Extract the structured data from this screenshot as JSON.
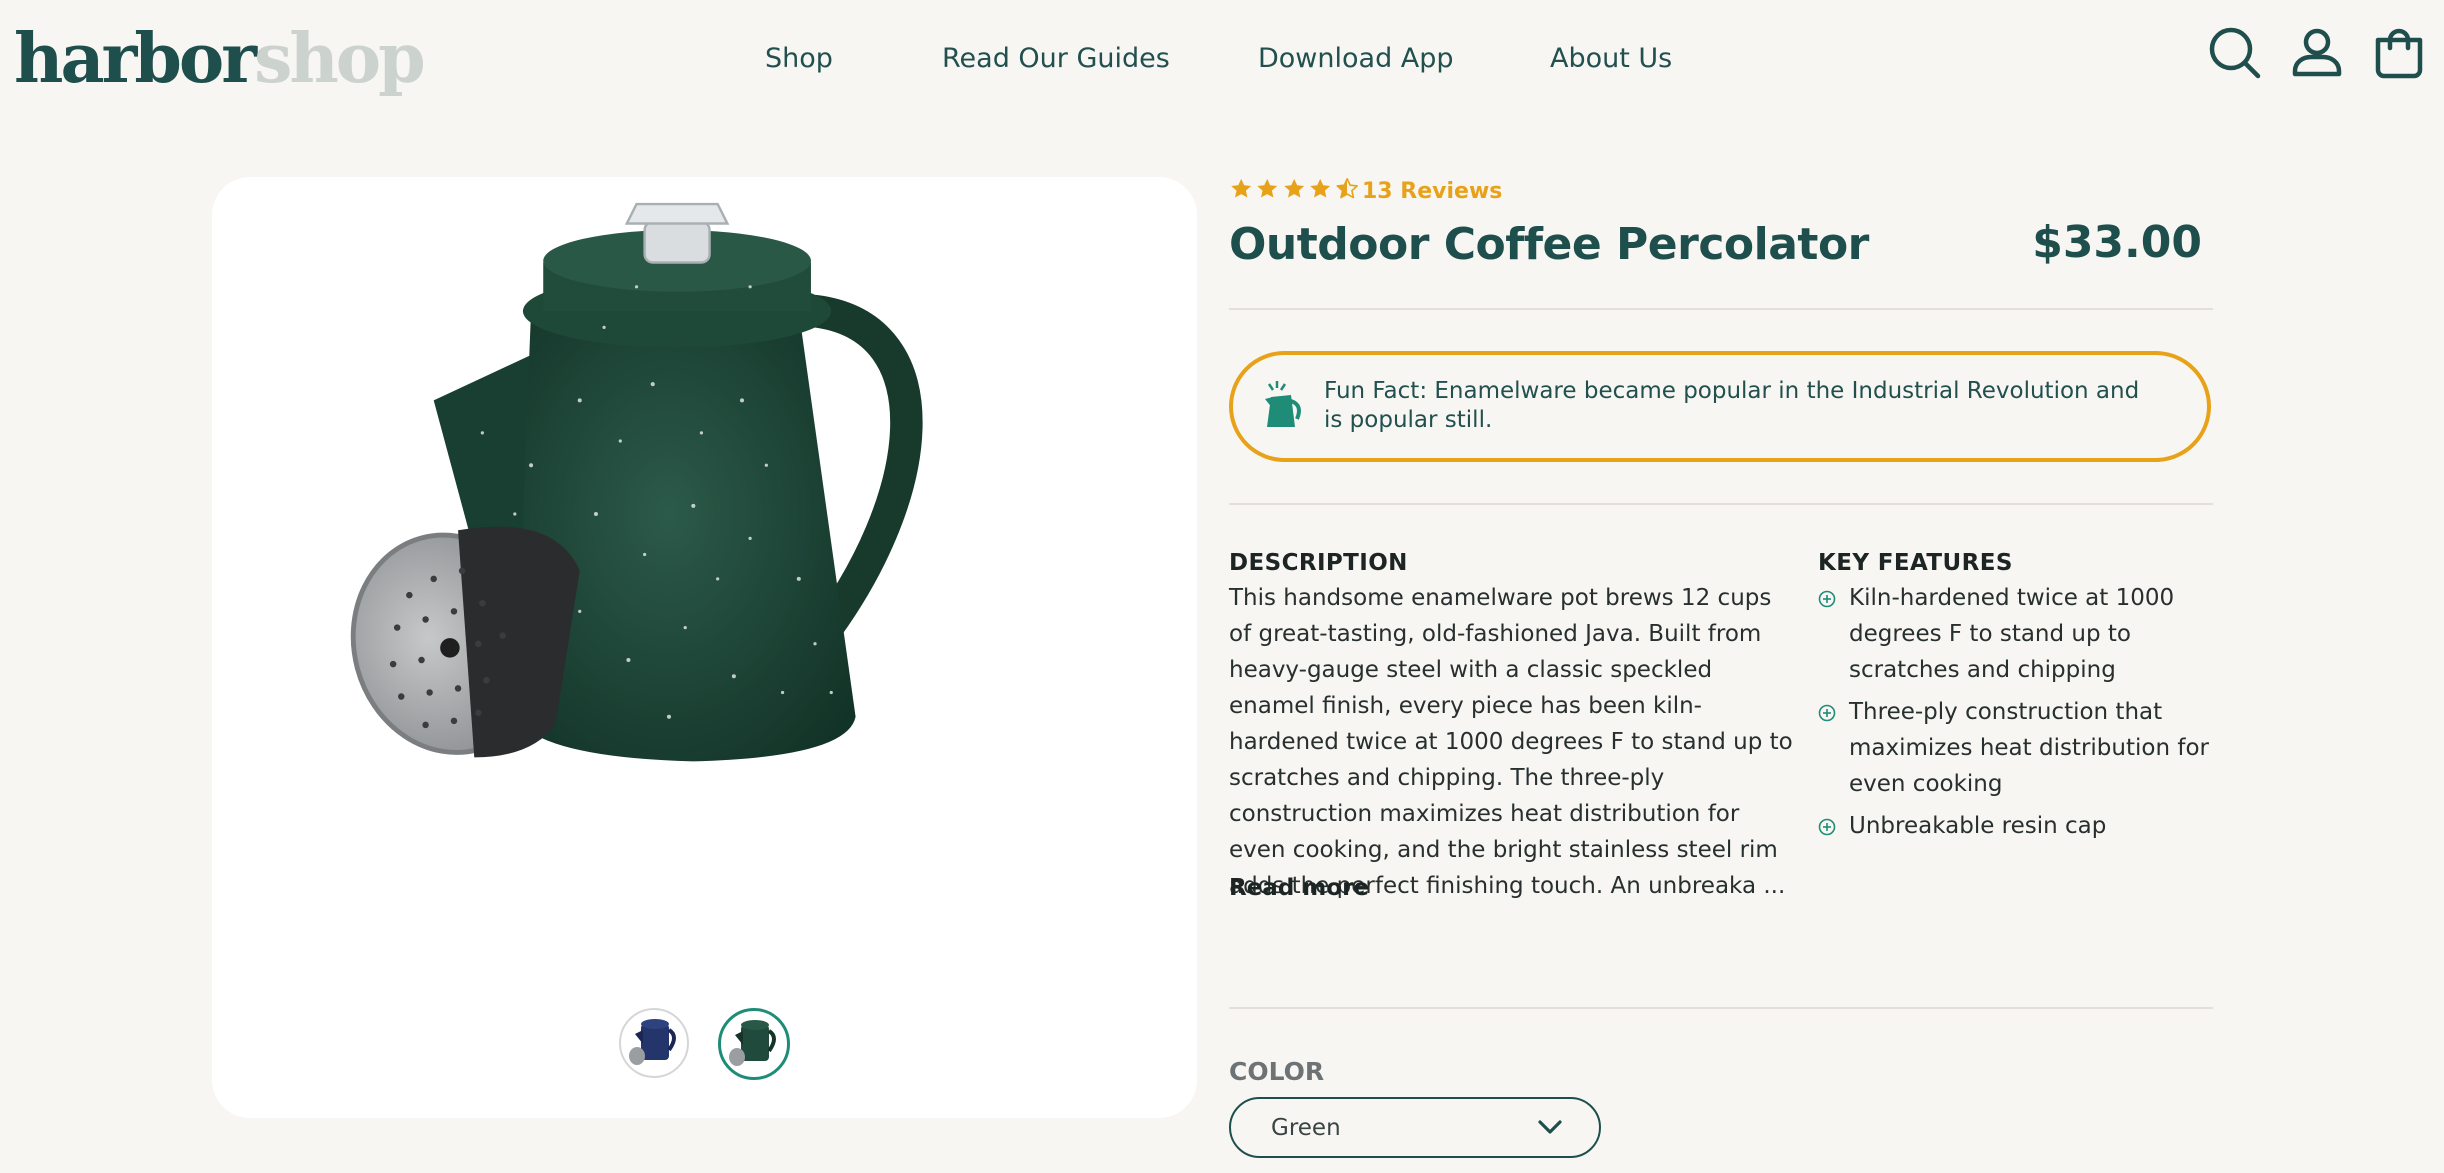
{
  "brand": {
    "part1": "harbor",
    "part2": "shop"
  },
  "nav": {
    "items": [
      {
        "label": "Shop"
      },
      {
        "label": "Read Our Guides"
      },
      {
        "label": "Download App"
      },
      {
        "label": "About Us"
      }
    ]
  },
  "header_icons": [
    "search-icon",
    "account-icon",
    "cart-icon"
  ],
  "product": {
    "rating": 4.5,
    "rating_max": 5,
    "reviews_label": "13 Reviews",
    "title": "Outdoor Coffee Percolator",
    "price": "$33.00",
    "fun_fact": "Fun Fact: Enamelware became popular in the Industrial Revolution and is popular still.",
    "description_heading": "DESCRIPTION",
    "description": "This handsome enamelware pot brews 12 cups of great-tasting, old-fashioned Java. Built from heavy-gauge steel with a classic speckled enamel finish, every piece has been kiln-hardened twice at 1000 degrees F to stand up to scratches and chipping. The three-ply construction maximizes heat distribution for even cooking, and the bright stainless steel rim adds the perfect finishing touch. An unbreaka ...",
    "read_more": "Read more",
    "features_heading": "KEY FEATURES",
    "features": [
      "Kiln-hardened twice at 1000 degrees F to stand up to scratches and chipping",
      "Three-ply construction that maximizes heat distribution for even cooking",
      "Unbreakable resin cap"
    ],
    "color_label": "COLOR",
    "color_selected": "Green",
    "thumbnails": [
      {
        "color": "blue",
        "hex": "#24356b",
        "selected": false
      },
      {
        "color": "green",
        "hex": "#1f4a3c",
        "selected": true
      }
    ]
  },
  "colors": {
    "brand_dark": "#1f4f4d",
    "brand_light": "#ccd2cd",
    "accent": "#e8a21a",
    "teal": "#1e8c76",
    "background": "#f8f6f3"
  }
}
